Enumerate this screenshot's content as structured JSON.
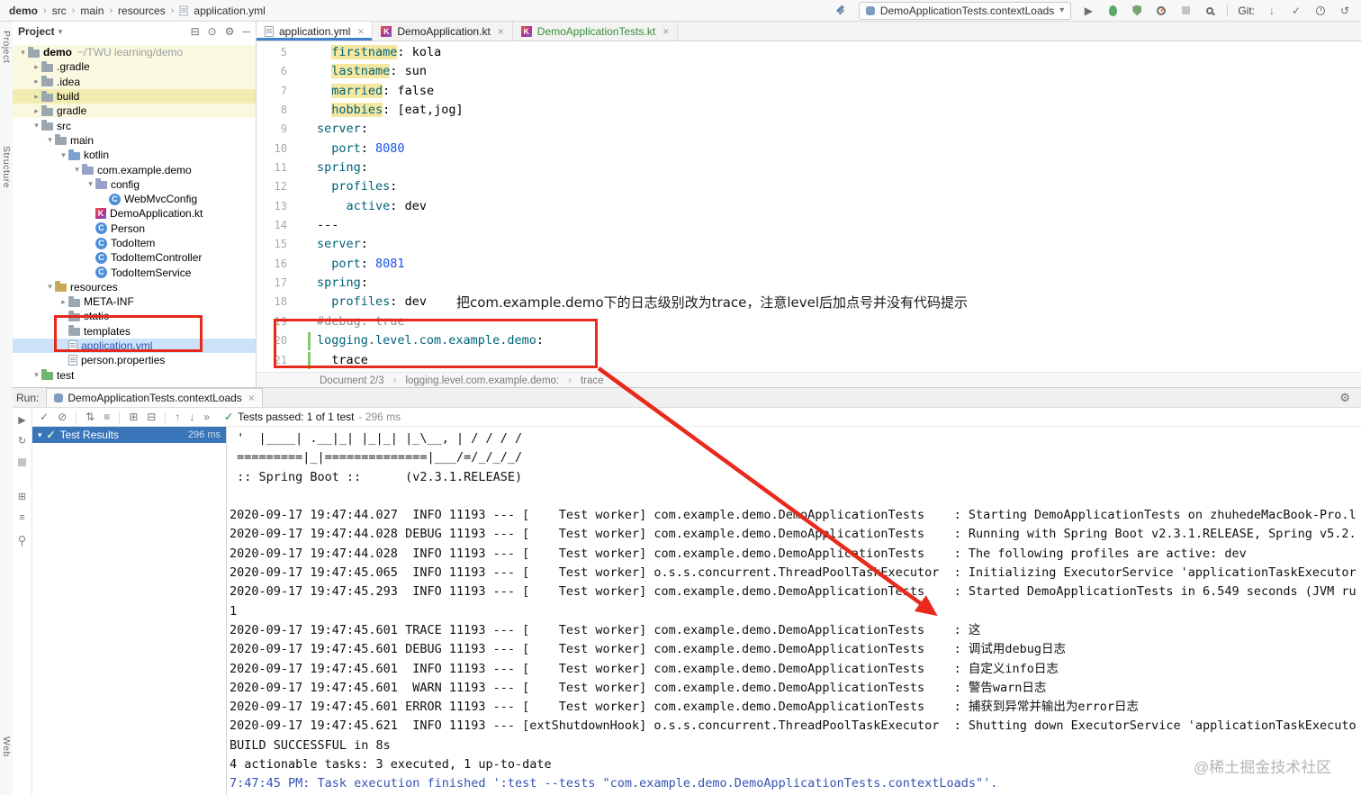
{
  "topbar": {
    "breadcrumbs": [
      "demo",
      "src",
      "main",
      "resources",
      "application.yml"
    ],
    "run_config": "DemoApplicationTests.contextLoads",
    "git_label": "Git:"
  },
  "tool_strip": {
    "top": [
      "Project",
      "Structure"
    ],
    "bottom": [
      "Web"
    ]
  },
  "project_panel": {
    "title": "Project",
    "tree": [
      {
        "label": "demo",
        "sub": "~/TWU learning/demo",
        "icon": "folder",
        "indent": 0,
        "arrow": "down",
        "row": "pale",
        "bold": true
      },
      {
        "label": ".gradle",
        "icon": "folder",
        "indent": 1,
        "arrow": "right",
        "row": "pale"
      },
      {
        "label": ".idea",
        "icon": "folder",
        "indent": 1,
        "arrow": "right",
        "row": "pale"
      },
      {
        "label": "build",
        "icon": "folder",
        "indent": 1,
        "arrow": "right",
        "row": "yellow"
      },
      {
        "label": "gradle",
        "icon": "folder",
        "indent": 1,
        "arrow": "right",
        "row": "pale"
      },
      {
        "label": "src",
        "icon": "folder",
        "indent": 1,
        "arrow": "down"
      },
      {
        "label": "main",
        "icon": "folder",
        "indent": 2,
        "arrow": "down"
      },
      {
        "label": "kotlin",
        "icon": "folder-blue",
        "indent": 3,
        "arrow": "down"
      },
      {
        "label": "com.example.demo",
        "icon": "package",
        "indent": 4,
        "arrow": "down"
      },
      {
        "label": "config",
        "icon": "package",
        "indent": 5,
        "arrow": "down"
      },
      {
        "label": "WebMvcConfig",
        "icon": "class",
        "indent": 6
      },
      {
        "label": "DemoApplication.kt",
        "icon": "kotlin",
        "indent": 5
      },
      {
        "label": "Person",
        "icon": "class",
        "indent": 5
      },
      {
        "label": "TodoItem",
        "icon": "class",
        "indent": 5
      },
      {
        "label": "TodoItemController",
        "icon": "class",
        "indent": 5
      },
      {
        "label": "TodoItemService",
        "icon": "class",
        "indent": 5
      },
      {
        "label": "resources",
        "icon": "folder-res",
        "indent": 2,
        "arrow": "down"
      },
      {
        "label": "META-INF",
        "icon": "folder",
        "indent": 3,
        "arrow": "right"
      },
      {
        "label": "static",
        "icon": "folder",
        "indent": 3
      },
      {
        "label": "templates",
        "icon": "folder",
        "indent": 3
      },
      {
        "label": "application.yml",
        "icon": "yml",
        "indent": 3,
        "row": "selected"
      },
      {
        "label": "person.properties",
        "icon": "props",
        "indent": 3
      },
      {
        "label": "test",
        "icon": "folder-test",
        "indent": 1,
        "arrow": "down"
      }
    ]
  },
  "editor": {
    "tabs": [
      {
        "label": "application.yml",
        "kind": "yml",
        "active": true
      },
      {
        "label": "DemoApplication.kt",
        "kind": "kt"
      },
      {
        "label": "DemoApplicationTests.kt",
        "kind": "kt-test"
      }
    ],
    "lines": [
      {
        "n": 5,
        "tokens": [
          {
            "t": "  ",
            "c": "t"
          },
          {
            "t": "firstname",
            "c": "khl"
          },
          {
            "t": ": ",
            "c": "t"
          },
          {
            "t": "kola",
            "c": "t"
          }
        ]
      },
      {
        "n": 6,
        "tokens": [
          {
            "t": "  ",
            "c": "t"
          },
          {
            "t": "lastname",
            "c": "khl"
          },
          {
            "t": ": ",
            "c": "t"
          },
          {
            "t": "sun",
            "c": "t"
          }
        ]
      },
      {
        "n": 7,
        "tokens": [
          {
            "t": "  ",
            "c": "t"
          },
          {
            "t": "married",
            "c": "khl"
          },
          {
            "t": ": ",
            "c": "t"
          },
          {
            "t": "false",
            "c": "t"
          }
        ]
      },
      {
        "n": 8,
        "tokens": [
          {
            "t": "  ",
            "c": "t"
          },
          {
            "t": "hobbies",
            "c": "khl"
          },
          {
            "t": ": ",
            "c": "t"
          },
          {
            "t": "[eat,jog]",
            "c": "t"
          }
        ]
      },
      {
        "n": 9,
        "tokens": [
          {
            "t": "server",
            "c": "k"
          },
          {
            "t": ":",
            "c": "t"
          }
        ]
      },
      {
        "n": 10,
        "tokens": [
          {
            "t": "  ",
            "c": "t"
          },
          {
            "t": "port",
            "c": "k"
          },
          {
            "t": ": ",
            "c": "t"
          },
          {
            "t": "8080",
            "c": "num"
          }
        ]
      },
      {
        "n": 11,
        "tokens": [
          {
            "t": "spring",
            "c": "k"
          },
          {
            "t": ":",
            "c": "t"
          }
        ]
      },
      {
        "n": 12,
        "tokens": [
          {
            "t": "  ",
            "c": "t"
          },
          {
            "t": "profiles",
            "c": "k"
          },
          {
            "t": ":",
            "c": "t"
          }
        ]
      },
      {
        "n": 13,
        "tokens": [
          {
            "t": "    ",
            "c": "t"
          },
          {
            "t": "active",
            "c": "k"
          },
          {
            "t": ": ",
            "c": "t"
          },
          {
            "t": "dev",
            "c": "t"
          }
        ]
      },
      {
        "n": 14,
        "tokens": [
          {
            "t": "---",
            "c": "t"
          }
        ]
      },
      {
        "n": 15,
        "tokens": [
          {
            "t": "server",
            "c": "k"
          },
          {
            "t": ":",
            "c": "t"
          }
        ]
      },
      {
        "n": 16,
        "tokens": [
          {
            "t": "  ",
            "c": "t"
          },
          {
            "t": "port",
            "c": "k"
          },
          {
            "t": ": ",
            "c": "t"
          },
          {
            "t": "8081",
            "c": "num"
          }
        ]
      },
      {
        "n": 17,
        "tokens": [
          {
            "t": "spring",
            "c": "k"
          },
          {
            "t": ":",
            "c": "t"
          }
        ]
      },
      {
        "n": 18,
        "tokens": [
          {
            "t": "  ",
            "c": "t"
          },
          {
            "t": "profiles",
            "c": "k"
          },
          {
            "t": ": ",
            "c": "t"
          },
          {
            "t": "dev",
            "c": "t"
          }
        ]
      },
      {
        "n": 19,
        "tokens": [
          {
            "t": "#debug: true",
            "c": "cmt"
          }
        ]
      },
      {
        "n": 20,
        "mark": true,
        "tokens": [
          {
            "t": "logging.level.com.example.demo",
            "c": "k"
          },
          {
            "t": ":",
            "c": "t"
          }
        ]
      },
      {
        "n": 21,
        "mark": true,
        "tokens": [
          {
            "t": "  ",
            "c": "t"
          },
          {
            "t": "trace",
            "c": "t"
          }
        ]
      }
    ],
    "breadcrumb": [
      "Document 2/3",
      "logging.level.com.example.demo:",
      "trace"
    ],
    "note": "把com.example.demo下的日志级别改为trace，注意level后加点号并没有代码提示"
  },
  "run_panel": {
    "label": "Run:",
    "tab": "DemoApplicationTests.contextLoads",
    "status": "Tests passed: 1 of 1 test",
    "status_duration": "- 296 ms",
    "tree": {
      "label": "Test Results",
      "duration": "296 ms"
    },
    "console": [
      {
        "t": " '  |____| .__|_| |_|_| |_\\__, | / / / /"
      },
      {
        "t": " =========|_|==============|___/=/_/_/_/"
      },
      {
        "t": " :: Spring Boot ::      (v2.3.1.RELEASE)"
      },
      {
        "t": ""
      },
      {
        "t": "2020-09-17 19:47:44.027  INFO 11193 --- [    Test worker] com.example.demo.DemoApplicationTests    : Starting DemoApplicationTests on zhuhedeMacBook-Pro.l"
      },
      {
        "t": "2020-09-17 19:47:44.028 DEBUG 11193 --- [    Test worker] com.example.demo.DemoApplicationTests    : Running with Spring Boot v2.3.1.RELEASE, Spring v5.2."
      },
      {
        "t": "2020-09-17 19:47:44.028  INFO 11193 --- [    Test worker] com.example.demo.DemoApplicationTests    : The following profiles are active: dev"
      },
      {
        "t": "2020-09-17 19:47:45.065  INFO 11193 --- [    Test worker] o.s.s.concurrent.ThreadPoolTaskExecutor  : Initializing ExecutorService 'applicationTaskExecutor"
      },
      {
        "t": "2020-09-17 19:47:45.293  INFO 11193 --- [    Test worker] com.example.demo.DemoApplicationTests    : Started DemoApplicationTests in 6.549 seconds (JVM ru"
      },
      {
        "t": "1"
      },
      {
        "t": "2020-09-17 19:47:45.601 TRACE 11193 --- [    Test worker] com.example.demo.DemoApplicationTests    : 这"
      },
      {
        "t": "2020-09-17 19:47:45.601 DEBUG 11193 --- [    Test worker] com.example.demo.DemoApplicationTests    : 调试用debug日志"
      },
      {
        "t": "2020-09-17 19:47:45.601  INFO 11193 --- [    Test worker] com.example.demo.DemoApplicationTests    : 自定义info日志"
      },
      {
        "t": "2020-09-17 19:47:45.601  WARN 11193 --- [    Test worker] com.example.demo.DemoApplicationTests    : 警告warn日志"
      },
      {
        "t": "2020-09-17 19:47:45.601 ERROR 11193 --- [    Test worker] com.example.demo.DemoApplicationTests    : 捕获到异常并输出为error日志"
      },
      {
        "t": "2020-09-17 19:47:45.621  INFO 11193 --- [extShutdownHook] o.s.s.concurrent.ThreadPoolTaskExecutor  : Shutting down ExecutorService 'applicationTaskExecuto"
      },
      {
        "t": "BUILD SUCCESSFUL in 8s"
      },
      {
        "t": "4 actionable tasks: 3 executed, 1 up-to-date"
      },
      {
        "t": "7:47:45 PM: Task execution finished ':test --tests \"com.example.demo.DemoApplicationTests.contextLoads\"'.",
        "c": "blue"
      }
    ]
  },
  "watermark": "@稀土掘金技术社区"
}
